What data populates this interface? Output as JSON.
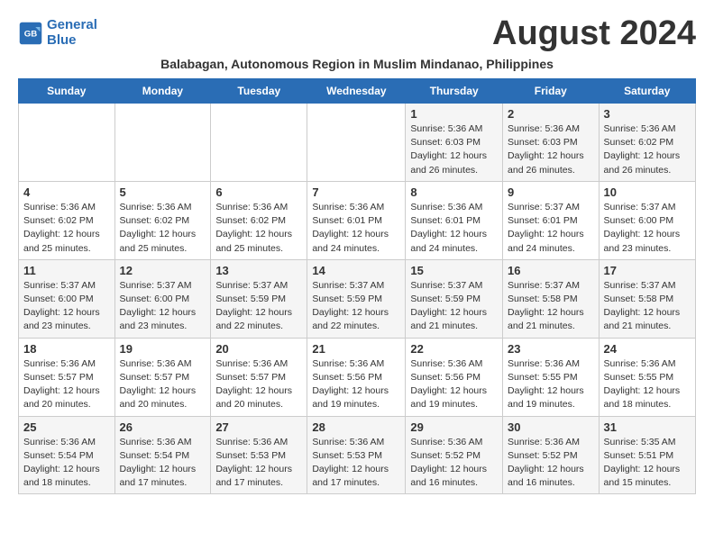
{
  "header": {
    "logo_line1": "General",
    "logo_line2": "Blue",
    "month_year": "August 2024",
    "subtitle": "Balabagan, Autonomous Region in Muslim Mindanao, Philippines"
  },
  "days_of_week": [
    "Sunday",
    "Monday",
    "Tuesday",
    "Wednesday",
    "Thursday",
    "Friday",
    "Saturday"
  ],
  "weeks": [
    [
      {
        "day": "",
        "info": ""
      },
      {
        "day": "",
        "info": ""
      },
      {
        "day": "",
        "info": ""
      },
      {
        "day": "",
        "info": ""
      },
      {
        "day": "1",
        "info": "Sunrise: 5:36 AM\nSunset: 6:03 PM\nDaylight: 12 hours\nand 26 minutes."
      },
      {
        "day": "2",
        "info": "Sunrise: 5:36 AM\nSunset: 6:03 PM\nDaylight: 12 hours\nand 26 minutes."
      },
      {
        "day": "3",
        "info": "Sunrise: 5:36 AM\nSunset: 6:02 PM\nDaylight: 12 hours\nand 26 minutes."
      }
    ],
    [
      {
        "day": "4",
        "info": "Sunrise: 5:36 AM\nSunset: 6:02 PM\nDaylight: 12 hours\nand 25 minutes."
      },
      {
        "day": "5",
        "info": "Sunrise: 5:36 AM\nSunset: 6:02 PM\nDaylight: 12 hours\nand 25 minutes."
      },
      {
        "day": "6",
        "info": "Sunrise: 5:36 AM\nSunset: 6:02 PM\nDaylight: 12 hours\nand 25 minutes."
      },
      {
        "day": "7",
        "info": "Sunrise: 5:36 AM\nSunset: 6:01 PM\nDaylight: 12 hours\nand 24 minutes."
      },
      {
        "day": "8",
        "info": "Sunrise: 5:36 AM\nSunset: 6:01 PM\nDaylight: 12 hours\nand 24 minutes."
      },
      {
        "day": "9",
        "info": "Sunrise: 5:37 AM\nSunset: 6:01 PM\nDaylight: 12 hours\nand 24 minutes."
      },
      {
        "day": "10",
        "info": "Sunrise: 5:37 AM\nSunset: 6:00 PM\nDaylight: 12 hours\nand 23 minutes."
      }
    ],
    [
      {
        "day": "11",
        "info": "Sunrise: 5:37 AM\nSunset: 6:00 PM\nDaylight: 12 hours\nand 23 minutes."
      },
      {
        "day": "12",
        "info": "Sunrise: 5:37 AM\nSunset: 6:00 PM\nDaylight: 12 hours\nand 23 minutes."
      },
      {
        "day": "13",
        "info": "Sunrise: 5:37 AM\nSunset: 5:59 PM\nDaylight: 12 hours\nand 22 minutes."
      },
      {
        "day": "14",
        "info": "Sunrise: 5:37 AM\nSunset: 5:59 PM\nDaylight: 12 hours\nand 22 minutes."
      },
      {
        "day": "15",
        "info": "Sunrise: 5:37 AM\nSunset: 5:59 PM\nDaylight: 12 hours\nand 21 minutes."
      },
      {
        "day": "16",
        "info": "Sunrise: 5:37 AM\nSunset: 5:58 PM\nDaylight: 12 hours\nand 21 minutes."
      },
      {
        "day": "17",
        "info": "Sunrise: 5:37 AM\nSunset: 5:58 PM\nDaylight: 12 hours\nand 21 minutes."
      }
    ],
    [
      {
        "day": "18",
        "info": "Sunrise: 5:36 AM\nSunset: 5:57 PM\nDaylight: 12 hours\nand 20 minutes."
      },
      {
        "day": "19",
        "info": "Sunrise: 5:36 AM\nSunset: 5:57 PM\nDaylight: 12 hours\nand 20 minutes."
      },
      {
        "day": "20",
        "info": "Sunrise: 5:36 AM\nSunset: 5:57 PM\nDaylight: 12 hours\nand 20 minutes."
      },
      {
        "day": "21",
        "info": "Sunrise: 5:36 AM\nSunset: 5:56 PM\nDaylight: 12 hours\nand 19 minutes."
      },
      {
        "day": "22",
        "info": "Sunrise: 5:36 AM\nSunset: 5:56 PM\nDaylight: 12 hours\nand 19 minutes."
      },
      {
        "day": "23",
        "info": "Sunrise: 5:36 AM\nSunset: 5:55 PM\nDaylight: 12 hours\nand 19 minutes."
      },
      {
        "day": "24",
        "info": "Sunrise: 5:36 AM\nSunset: 5:55 PM\nDaylight: 12 hours\nand 18 minutes."
      }
    ],
    [
      {
        "day": "25",
        "info": "Sunrise: 5:36 AM\nSunset: 5:54 PM\nDaylight: 12 hours\nand 18 minutes."
      },
      {
        "day": "26",
        "info": "Sunrise: 5:36 AM\nSunset: 5:54 PM\nDaylight: 12 hours\nand 17 minutes."
      },
      {
        "day": "27",
        "info": "Sunrise: 5:36 AM\nSunset: 5:53 PM\nDaylight: 12 hours\nand 17 minutes."
      },
      {
        "day": "28",
        "info": "Sunrise: 5:36 AM\nSunset: 5:53 PM\nDaylight: 12 hours\nand 17 minutes."
      },
      {
        "day": "29",
        "info": "Sunrise: 5:36 AM\nSunset: 5:52 PM\nDaylight: 12 hours\nand 16 minutes."
      },
      {
        "day": "30",
        "info": "Sunrise: 5:36 AM\nSunset: 5:52 PM\nDaylight: 12 hours\nand 16 minutes."
      },
      {
        "day": "31",
        "info": "Sunrise: 5:35 AM\nSunset: 5:51 PM\nDaylight: 12 hours\nand 15 minutes."
      }
    ]
  ]
}
